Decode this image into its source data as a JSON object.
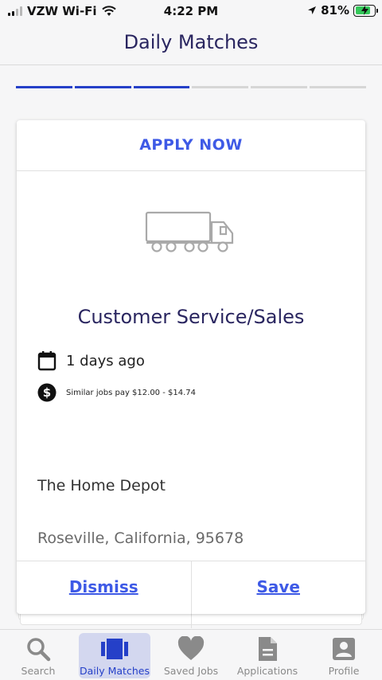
{
  "status": {
    "carrier": "VZW Wi-Fi",
    "time": "4:22 PM",
    "battery": "81%",
    "battery_level": 0.81
  },
  "header": {
    "title": "Daily Matches"
  },
  "progress": {
    "total_steps": 6,
    "completed_steps": 3,
    "active_color": "#2540c8"
  },
  "card": {
    "apply_label": "APPLY NOW",
    "illustration": "truck-icon",
    "job_title": "Customer Service/Sales",
    "posted": "1 days ago",
    "pay": "Similar jobs pay $12.00 - $14.74",
    "company": "The Home Depot",
    "location": "Roseville, California, 95678",
    "dismiss_label": "Dismiss",
    "save_label": "Save"
  },
  "tabs": [
    {
      "label": "Search",
      "icon": "search-icon"
    },
    {
      "label": "Daily Matches",
      "icon": "cards-icon",
      "active": true
    },
    {
      "label": "Saved Jobs",
      "icon": "heart-icon"
    },
    {
      "label": "Applications",
      "icon": "document-icon"
    },
    {
      "label": "Profile",
      "icon": "profile-icon"
    }
  ],
  "colors": {
    "accent": "#3e5ae6",
    "title": "#2a2660",
    "active_tab_bg": "#d3d7ef"
  }
}
